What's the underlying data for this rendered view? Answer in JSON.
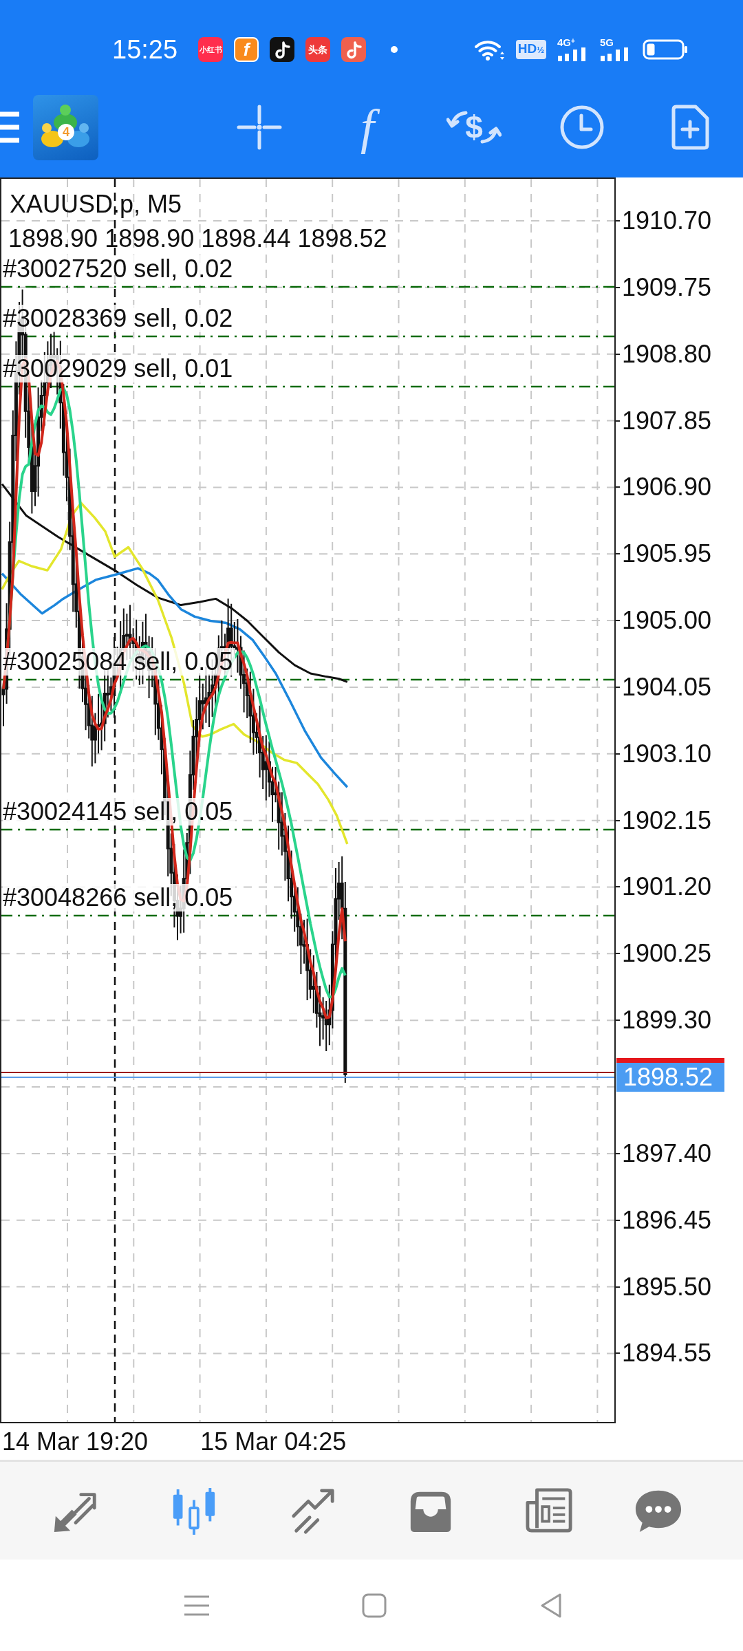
{
  "status_bar": {
    "time": "15:25",
    "notifications": [
      {
        "kind": "text",
        "label": "小红书",
        "color": "#ff2e4d"
      },
      {
        "kind": "text",
        "label": "f",
        "color": "#f98a1c"
      },
      {
        "kind": "note",
        "color": "#111111"
      },
      {
        "kind": "text",
        "label": "头条",
        "color": "#ee3a3a"
      },
      {
        "kind": "note",
        "color": "#f0604d"
      }
    ],
    "volte": {
      "label": "HD",
      "fraction": "½"
    },
    "networks": [
      "4G$^{+}$",
      "5G"
    ]
  },
  "toolbar": {
    "logo_badge": "4",
    "indicator_glyph": "f",
    "trade_glyph": "$"
  },
  "chart": {
    "symbol": "XAUUSD.p, M5",
    "ohlc": "1898.90 1898.90 1898.44 1898.52",
    "orders": [
      "#30027520 sell, 0.02",
      "#30028369 sell, 0.02",
      "#30029029 sell, 0.01",
      "#30025084 sell, 0.05",
      "#30024145 sell, 0.05",
      "#30048266 sell, 0.05"
    ],
    "price_axis": {
      "upper": [
        "1910.70",
        "1909.75",
        "1908.80",
        "1907.85",
        "1906.90",
        "1905.95",
        "1905.00",
        "1904.05",
        "1903.10",
        "1902.15",
        "1901.20",
        "1900.25",
        "1899.30"
      ],
      "current_price": "1898.52",
      "lower": [
        "1897.40",
        "1896.45",
        "1895.50",
        "1894.55"
      ]
    },
    "time_axis": [
      "14 Mar 19:20",
      "15 Mar 04:25"
    ]
  },
  "bottom_tabs": [
    {
      "kind": "quotes",
      "selected": false
    },
    {
      "kind": "chart",
      "selected": true
    },
    {
      "kind": "trade",
      "selected": false
    },
    {
      "kind": "history",
      "selected": false
    },
    {
      "kind": "news",
      "selected": false
    },
    {
      "kind": "chat",
      "selected": false
    }
  ]
}
